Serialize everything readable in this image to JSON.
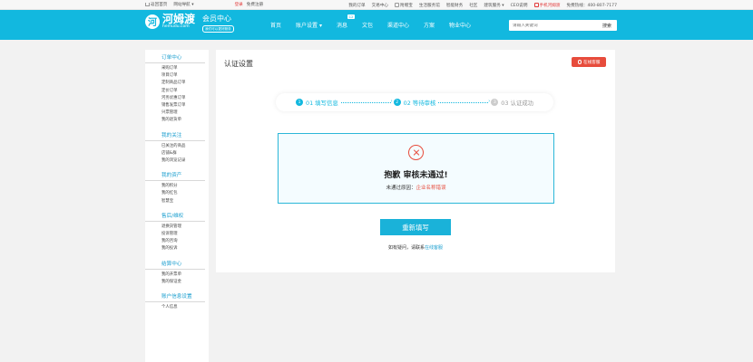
{
  "topbar": {
    "back_home": "返回首页",
    "sites": "网站导航",
    "login": "登录",
    "register": "免费注册",
    "links": [
      "我的订单",
      "交易中心",
      "附赠宝",
      "生活服务馆",
      "智能财务",
      "社区",
      "建筑服务",
      "CEO说明"
    ],
    "phone_link": "手机河姆渡",
    "hotline": "免费热线：400-807-7177"
  },
  "header": {
    "logo_glyph": "河",
    "logo_name": "河姆渡",
    "logo_domain": "hemudu.com",
    "member_title": "会员中心",
    "member_tag": "我们可以更好服务",
    "nav": [
      "首页",
      "账户设置",
      "消息",
      "文包",
      "渠道中心",
      "方案",
      "物业中心"
    ],
    "msg_badge": "12",
    "search_placeholder": "请输入关键词",
    "search_button": "搜索"
  },
  "sidebar": [
    {
      "title": "订单中心",
      "items": [
        "采购订单",
        "项目订单",
        "定制商品订单",
        "定价订单",
        "河务优惠订单",
        "销售发票订单",
        "兴票管理",
        "我的退货单"
      ]
    },
    {
      "title": "我的关注",
      "items": [
        "已关注的商品",
        "店铺&群",
        "我的浏览记录"
      ]
    },
    {
      "title": "我的资产",
      "items": [
        "我的积分",
        "我的红包",
        "智慧宝"
      ]
    },
    {
      "title": "售后/维权",
      "items": [
        "退换货管理",
        "投诉管理",
        "我的咨询",
        "我的投诉"
      ]
    },
    {
      "title": "结算中心",
      "items": [
        "我的开票单",
        "我的保证金"
      ]
    },
    {
      "title": "账户信息设置",
      "items": [
        "个人信息"
      ]
    }
  ],
  "main": {
    "title": "认证设置",
    "service_button": "在线客服",
    "steps": [
      {
        "num": "1",
        "label": "01 填写信息",
        "state": "done"
      },
      {
        "num": "2",
        "label": "02 等待审核",
        "state": "active"
      },
      {
        "num": "3",
        "label": "03 认证成功",
        "state": "pending"
      }
    ],
    "fail_title": "抱歉 审核未通过!",
    "fail_reason_label": "未通过原因：",
    "fail_reason_value": "企业名称错误",
    "refill_button": "重新填写",
    "help_text": "如有疑问，请联系",
    "help_link": "在线客服"
  },
  "colors": {
    "accent": "#12b8df",
    "error": "#e74c3c"
  }
}
